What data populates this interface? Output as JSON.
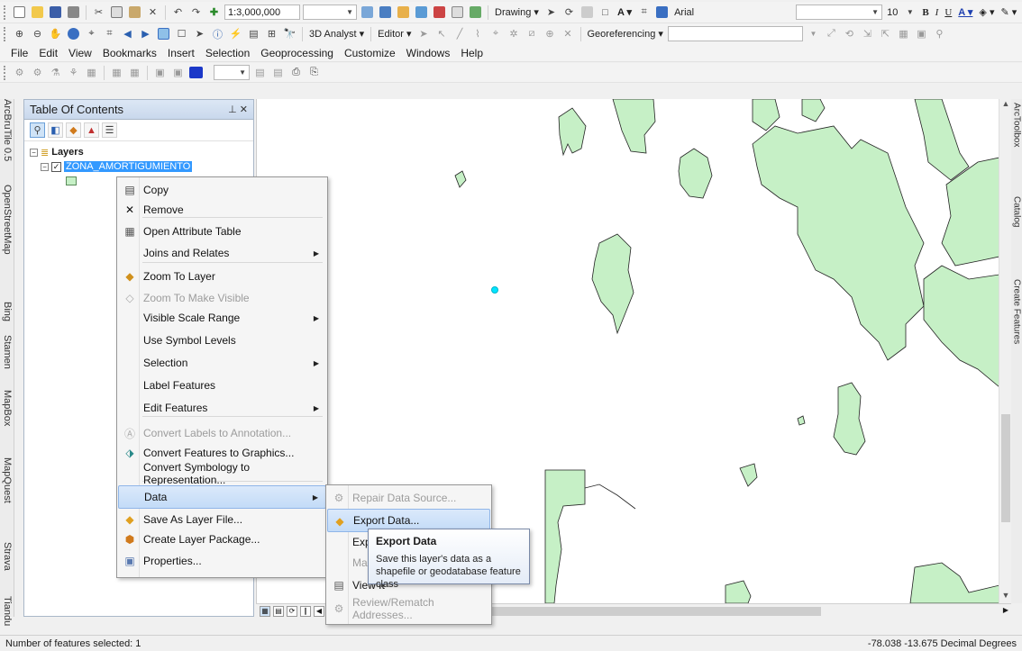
{
  "toolbar1": {
    "scale": "1:3,000,000",
    "drawing_label": "Drawing",
    "font_name": "Arial",
    "font_size": "10"
  },
  "toolbar2": {
    "analyst_label": "3D Analyst",
    "editor_label": "Editor",
    "georef_label": "Georeferencing"
  },
  "menubar": [
    "File",
    "Edit",
    "View",
    "Bookmarks",
    "Insert",
    "Selection",
    "Geoprocessing",
    "Customize",
    "Windows",
    "Help"
  ],
  "left_tabs": [
    "ArcBruTile 0.5",
    "OpenStreetMap",
    "Bing",
    "Stamen",
    "MapBox",
    "MapQuest",
    "Strava",
    "Tiandu"
  ],
  "right_tabs": [
    "ArcToolbox",
    "Catalog",
    "Create Features"
  ],
  "toc": {
    "title": "Table Of Contents",
    "controls": "2 ×",
    "root_label": "Layers",
    "layer_name": "ZONA_AMORTIGUMIENTO"
  },
  "context_menu": {
    "items": [
      {
        "label": "Copy",
        "icon": "copy-icon",
        "enabled": true
      },
      {
        "label": "Remove",
        "icon": "remove-icon",
        "enabled": true
      },
      {
        "label": "Open Attribute Table",
        "icon": "table-icon",
        "enabled": true
      },
      {
        "label": "Joins and Relates",
        "icon": "",
        "enabled": true,
        "submenu": true
      },
      {
        "label": "Zoom To Layer",
        "icon": "zoom-layer-icon",
        "enabled": true
      },
      {
        "label": "Zoom To Make Visible",
        "icon": "zoom-visible-icon",
        "enabled": false
      },
      {
        "label": "Visible Scale Range",
        "icon": "",
        "enabled": true,
        "submenu": true
      },
      {
        "label": "Use Symbol Levels",
        "icon": "",
        "enabled": true
      },
      {
        "label": "Selection",
        "icon": "",
        "enabled": true,
        "submenu": true
      },
      {
        "label": "Label Features",
        "icon": "",
        "enabled": true
      },
      {
        "label": "Edit Features",
        "icon": "",
        "enabled": true,
        "submenu": true
      },
      {
        "label": "Convert Labels to Annotation...",
        "icon": "annotation-icon",
        "enabled": false
      },
      {
        "label": "Convert Features to Graphics...",
        "icon": "graphics-icon",
        "enabled": true
      },
      {
        "label": "Convert Symbology to Representation...",
        "icon": "",
        "enabled": true
      },
      {
        "label": "Data",
        "icon": "",
        "enabled": true,
        "submenu": true,
        "highlighted": true
      },
      {
        "label": "Save As Layer File...",
        "icon": "layer-file-icon",
        "enabled": true
      },
      {
        "label": "Create Layer Package...",
        "icon": "layer-package-icon",
        "enabled": true
      },
      {
        "label": "Properties...",
        "icon": "properties-icon",
        "enabled": true
      }
    ]
  },
  "data_submenu": {
    "items": [
      {
        "label": "Repair Data Source...",
        "enabled": false
      },
      {
        "label": "Export Data...",
        "enabled": true,
        "highlighted": true
      },
      {
        "label": "Export",
        "enabled": true
      },
      {
        "label": "Make l",
        "enabled": false
      },
      {
        "label": "View It",
        "enabled": true
      },
      {
        "label": "Review/Rematch Addresses...",
        "enabled": false
      }
    ]
  },
  "tooltip": {
    "title": "Export Data",
    "body": "Save this layer's data as a shapefile or geodatabase feature class"
  },
  "status": {
    "selected": "Number of features selected: 1",
    "coords": "-78.038  -13.675 Decimal Degrees"
  },
  "colors": {
    "polygon_fill": "#c6f0c6",
    "polygon_stroke": "#222222",
    "selection": "#3399ff",
    "selected_point": "#00e5ff"
  }
}
